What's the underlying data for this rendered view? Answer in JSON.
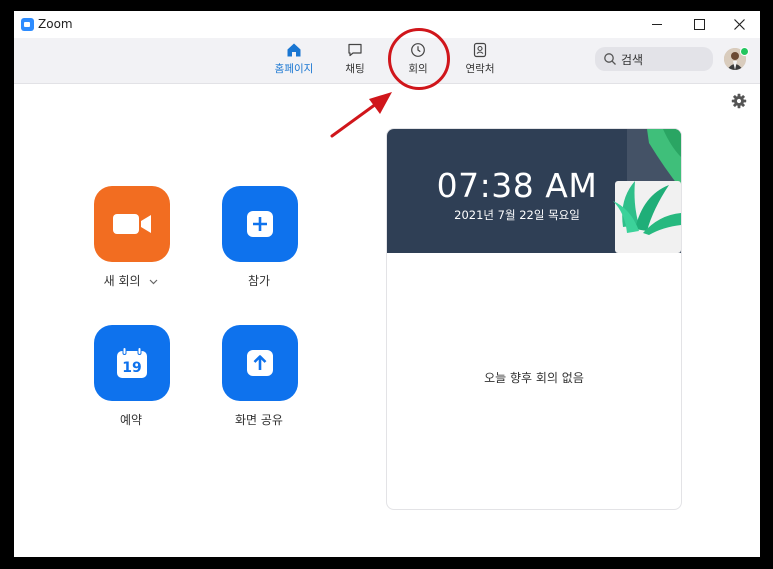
{
  "window": {
    "title": "Zoom",
    "minimize": "minimize",
    "maximize": "maximize",
    "close": "close"
  },
  "nav": {
    "items": [
      {
        "label": "홈페이지",
        "icon": "home-icon",
        "active": true
      },
      {
        "label": "채팅",
        "icon": "chat-icon",
        "active": false
      },
      {
        "label": "회의",
        "icon": "clock-icon",
        "active": false
      },
      {
        "label": "연락처",
        "icon": "contacts-icon",
        "active": false
      }
    ]
  },
  "search": {
    "text": "검색"
  },
  "actions": [
    {
      "label": "새 회의",
      "icon": "video-camera-icon",
      "color": "#f26d21"
    },
    {
      "label": "참가",
      "icon": "plus-icon",
      "color": "#0e72ed"
    },
    {
      "label": "예약",
      "icon": "calendar-icon",
      "color": "#0e72ed",
      "calendar_day": "19"
    },
    {
      "label": "화면 공유",
      "icon": "share-screen-icon",
      "color": "#0e72ed"
    }
  ],
  "clock": {
    "time": "07:38 AM",
    "date": "2021년 7월 22일 목요일",
    "empty_text": "오늘 향후 회의 없음"
  },
  "colors": {
    "accent": "#0e72ed",
    "orange": "#f26d21",
    "active_nav": "#1976d2",
    "annotation": "#d0161b",
    "banner": "#2f3f55"
  }
}
